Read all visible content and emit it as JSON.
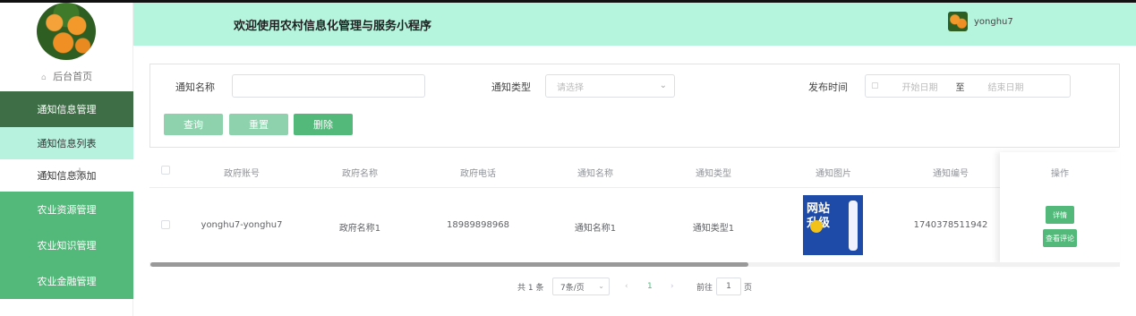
{
  "app": {
    "title": "欢迎使用农村信息化管理与服务小程序",
    "username": "yonghu7"
  },
  "sidebar": {
    "home_label": "后台首页",
    "items": [
      {
        "label": "通知信息管理"
      },
      {
        "label": "通知信息列表"
      },
      {
        "label": "通知信息添加"
      },
      {
        "label": "农业资源管理"
      },
      {
        "label": "农业知识管理"
      },
      {
        "label": "农业金融管理"
      }
    ]
  },
  "search": {
    "name_label": "通知名称",
    "name_placeholder": "",
    "type_label": "通知类型",
    "type_placeholder": "请选择",
    "date_label": "发布时间",
    "start_placeholder": "开始日期",
    "date_separator": "至",
    "end_placeholder": "结束日期",
    "query_button": "查询",
    "reset_button": "重置",
    "delete_button": "删除"
  },
  "table": {
    "columns": [
      "政府账号",
      "政府名称",
      "政府电话",
      "通知名称",
      "通知类型",
      "通知图片",
      "通知编号",
      "操作"
    ],
    "rows": [
      {
        "account": "yonghu7-yonghu7",
        "gov_name": "政府名称1",
        "phone": "18989898968",
        "notice_name": "通知名称1",
        "notice_type": "通知类型1",
        "image_text": "网站升级",
        "notice_no": "1740378511942",
        "detail_button": "详情",
        "comment_button": "查看评论"
      }
    ]
  },
  "pagination": {
    "total": "共 1 条",
    "page_size": "7条/页",
    "current_page": "1",
    "goto_label": "前往",
    "goto_value": "1",
    "page_suffix": "页"
  },
  "colors": {
    "header_bg": "#b5f5de",
    "menu_green": "#52b97a",
    "menu_dark": "#3e6e45",
    "active_sub": "#b7f2df"
  }
}
